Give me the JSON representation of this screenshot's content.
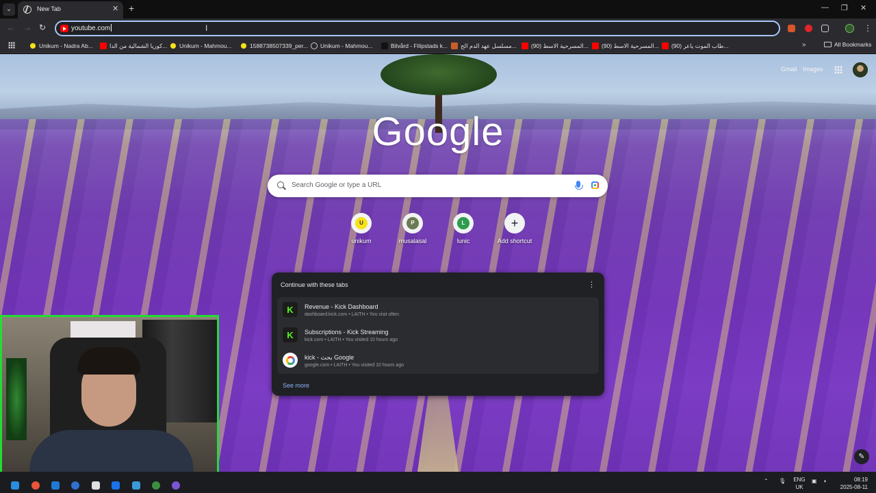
{
  "browser": {
    "tab_title": "New Tab",
    "omnibox_value": "youtube.com",
    "bookmarks": [
      {
        "label": "Unikum - Nadra Ab...",
        "icon": "unikum-icon"
      },
      {
        "label": "كوريا الشمالية من الدا...",
        "icon": "youtube-icon"
      },
      {
        "label": "Unikum - Mahmou...",
        "icon": "unikum-icon"
      },
      {
        "label": "1588738507339_per...",
        "icon": "unikum-icon"
      },
      {
        "label": "Unikum - Mahmou...",
        "icon": "globe-icon"
      },
      {
        "label": "Bilvård - Filipstads k...",
        "icon": "dark-icon"
      },
      {
        "label": "مسلسل عهد الدم الح...",
        "icon": "orange-icon"
      },
      {
        "label": "(90) المسرحية الاسط...",
        "icon": "youtube-icon"
      },
      {
        "label": "(90) المسرحية الاسط...",
        "icon": "youtube-icon"
      },
      {
        "label": "(90) طاب الموت ياعر...",
        "icon": "youtube-icon"
      }
    ],
    "all_bookmarks": "All Bookmarks"
  },
  "ntp": {
    "gmail": "Gmail",
    "images": "Images",
    "logo": "Google",
    "search_placeholder": "Search Google or type a URL",
    "shortcuts": [
      {
        "label": "unikum",
        "initial": "U",
        "color": "#f7e11a"
      },
      {
        "label": "musalasal",
        "initial": "P",
        "color": "#6b7b55"
      },
      {
        "label": "lunic",
        "initial": "L",
        "color": "#2e9b4f"
      },
      {
        "label": "Add shortcut",
        "initial": "+",
        "color": "#f1f3f4"
      }
    ],
    "continue": {
      "title": "Continue with these tabs",
      "items": [
        {
          "title": "Revenue - Kick Dashboard",
          "sub": "dashboard.kick.com • LAITH • You visit often",
          "icon": "kick-icon"
        },
        {
          "title": "Subscriptions - Kick Streaming",
          "sub": "kick.com • LAITH • You visited 10 hours ago",
          "icon": "kick-icon"
        },
        {
          "title": "kick - بحث Google",
          "sub": "google.com • LAITH • You visited 10 hours ago",
          "icon": "google-icon"
        }
      ],
      "see_more": "See more"
    }
  },
  "taskbar": {
    "lang_top": "ENG",
    "lang_bottom": "UK",
    "time": "08:19",
    "date": "2025-08-11"
  },
  "colors": {
    "accent": "#a8c7fa",
    "kick_green": "#53fc18",
    "webcam_border": "#22dd33"
  }
}
